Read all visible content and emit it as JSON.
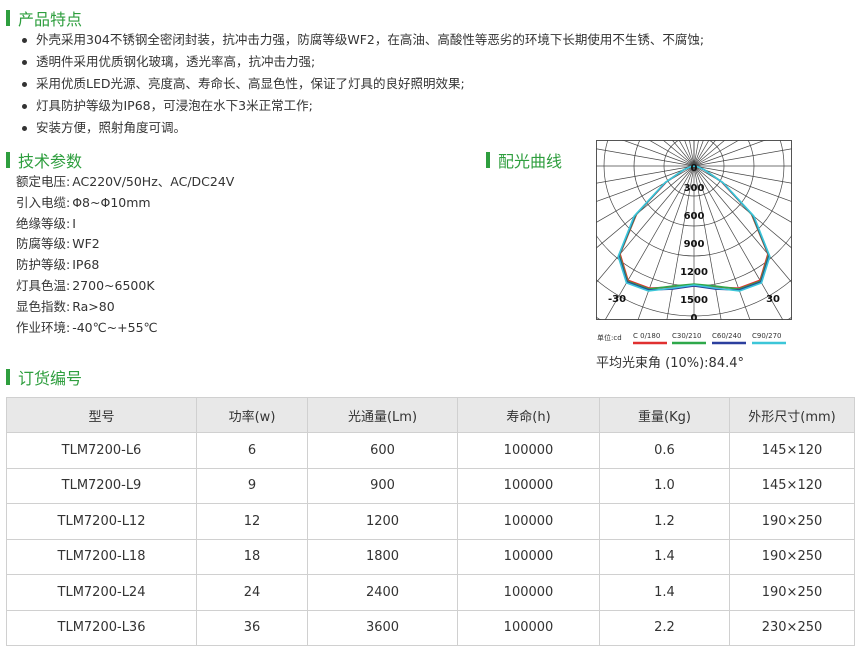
{
  "features": {
    "title": "产品特点",
    "items": [
      "外壳采用304不锈钢全密闭封装，抗冲击力强，防腐等级WF2，在高油、高酸性等恶劣的环境下长期使用不生锈、不腐蚀;",
      "透明件采用优质钢化玻璃，透光率高，抗冲击力强;",
      "采用优质LED光源、亮度高、寿命长、高显色性，保证了灯具的良好照明效果;",
      "灯具防护等级为IP68，可浸泡在水下3米正常工作;",
      "安装方便，照射角度可调。"
    ]
  },
  "params": {
    "title": "技术参数",
    "rows": [
      {
        "label": "额定电压:",
        "value": "AC220V/50Hz、AC/DC24V"
      },
      {
        "label": "引入电缆:",
        "value": "Φ8~Φ10mm"
      },
      {
        "label": "绝缘等级:",
        "value": "I"
      },
      {
        "label": "防腐等级:",
        "value": "WF2"
      },
      {
        "label": "防护等级:",
        "value": "IP68"
      },
      {
        "label": "灯具色温:",
        "value": "2700~6500K"
      },
      {
        "label": "显色指数:",
        "value": "Ra>80"
      },
      {
        "label": "作业环境:",
        "value": "-40℃~+55℃"
      }
    ]
  },
  "curve": {
    "title": "配光曲线",
    "beam_label": "平均光束角 (10%):84.4°",
    "chart_data": {
      "type": "polar",
      "unit_label": "单位:cd",
      "radial_ticks": [
        "300",
        "600",
        "900",
        "1200",
        "1500"
      ],
      "radial_max": 1500,
      "angle_labels": {
        "top": "0",
        "bottom": "0",
        "left": "-30",
        "right": "30"
      },
      "series": [
        {
          "name": "C 0/180",
          "color": "#e03030",
          "points": [
            [
              0,
              1200
            ],
            [
              10,
              1230
            ],
            [
              20,
              1300
            ],
            [
              30,
              1320
            ],
            [
              40,
              1150
            ],
            [
              50,
              750
            ],
            [
              60,
              320
            ],
            [
              70,
              100
            ],
            [
              80,
              30
            ],
            [
              90,
              0
            ]
          ]
        },
        {
          "name": "C30/210",
          "color": "#2ea84a",
          "points": [
            [
              0,
              1180
            ],
            [
              10,
              1220
            ],
            [
              20,
              1310
            ],
            [
              30,
              1330
            ],
            [
              40,
              1160
            ],
            [
              50,
              760
            ],
            [
              60,
              330
            ],
            [
              70,
              110
            ],
            [
              80,
              30
            ],
            [
              90,
              0
            ]
          ]
        },
        {
          "name": "C60/240",
          "color": "#2b3f9e",
          "points": [
            [
              0,
              1200
            ],
            [
              10,
              1250
            ],
            [
              20,
              1320
            ],
            [
              30,
              1340
            ],
            [
              40,
              1170
            ],
            [
              50,
              770
            ],
            [
              60,
              330
            ],
            [
              70,
              105
            ],
            [
              80,
              30
            ],
            [
              90,
              0
            ]
          ]
        },
        {
          "name": "C90/270",
          "color": "#3cc6d8",
          "points": [
            [
              0,
              1190
            ],
            [
              10,
              1240
            ],
            [
              20,
              1330
            ],
            [
              30,
              1350
            ],
            [
              40,
              1180
            ],
            [
              50,
              780
            ],
            [
              60,
              340
            ],
            [
              70,
              110
            ],
            [
              80,
              32
            ],
            [
              90,
              0
            ]
          ]
        }
      ]
    }
  },
  "order": {
    "title": "订货编号",
    "headers": [
      "型号",
      "功率(w)",
      "光通量(Lm)",
      "寿命(h)",
      "重量(Kg)",
      "外形尺寸(mm)"
    ],
    "rows": [
      [
        "TLM7200-L6",
        "6",
        "600",
        "100000",
        "0.6",
        "145×120"
      ],
      [
        "TLM7200-L9",
        "9",
        "900",
        "100000",
        "1.0",
        "145×120"
      ],
      [
        "TLM7200-L12",
        "12",
        "1200",
        "100000",
        "1.2",
        "190×250"
      ],
      [
        "TLM7200-L18",
        "18",
        "1800",
        "100000",
        "1.4",
        "190×250"
      ],
      [
        "TLM7200-L24",
        "24",
        "2400",
        "100000",
        "1.4",
        "190×250"
      ],
      [
        "TLM7200-L36",
        "36",
        "3600",
        "100000",
        "2.2",
        "230×250"
      ]
    ]
  }
}
